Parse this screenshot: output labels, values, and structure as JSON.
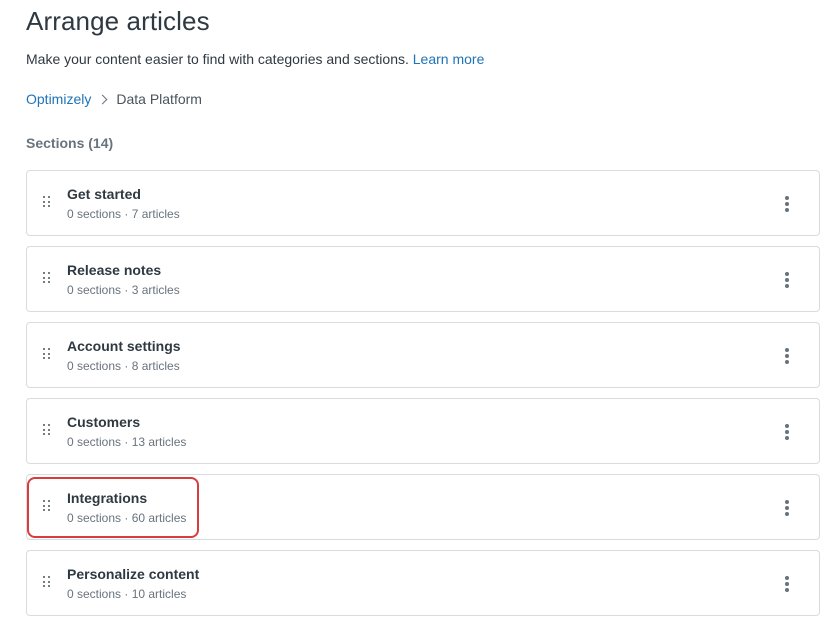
{
  "page": {
    "title": "Arrange articles",
    "subtitle": "Make your content easier to find with categories and sections.",
    "learn_more": "Learn more"
  },
  "breadcrumb": {
    "parent": "Optimizely",
    "current": "Data Platform"
  },
  "sections_heading": "Sections (14)",
  "sections": [
    {
      "title": "Get started",
      "meta": "0 sections · 7 articles"
    },
    {
      "title": "Release notes",
      "meta": "0 sections · 3 articles"
    },
    {
      "title": "Account settings",
      "meta": "0 sections · 8 articles"
    },
    {
      "title": "Customers",
      "meta": "0 sections · 13 articles"
    },
    {
      "title": "Integrations",
      "meta": "0 sections · 60 articles"
    },
    {
      "title": "Personalize content",
      "meta": "0 sections · 10 articles"
    }
  ],
  "colors": {
    "link": "#1f73b7",
    "highlight": "#d93c3c",
    "border": "#d8dcde"
  },
  "icons": {
    "drag_handle": "drag-handle-icon",
    "more": "overflow-menu-icon",
    "breadcrumb_separator": "chevron-right-icon"
  }
}
